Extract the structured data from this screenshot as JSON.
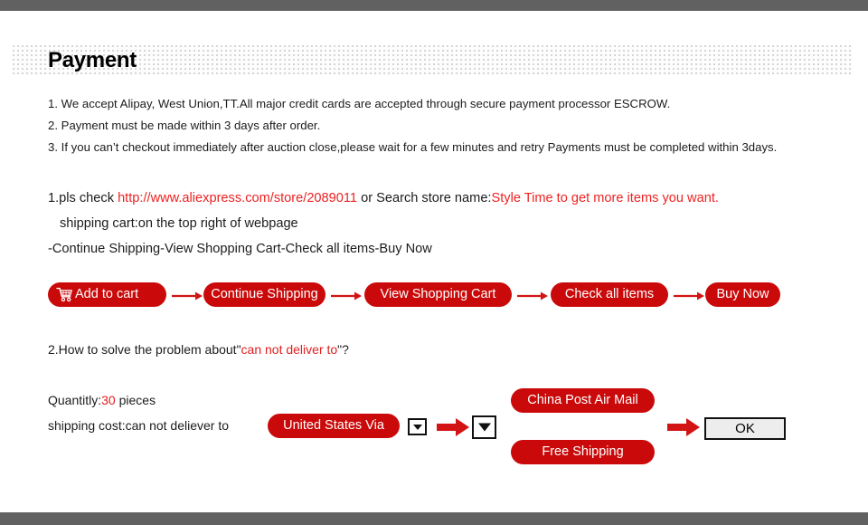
{
  "page": {
    "title": "Payment",
    "accent_red": "#ca0a0a",
    "text_red": "#ee2222",
    "bar_gray": "#616161"
  },
  "terms": {
    "item1": "1. We accept Alipay, West Union,TT.All major credit cards are accepted through secure payment processor ESCROW.",
    "item2": "2. Payment must be made within 3 days after order.",
    "item3": "3. If you can’t checkout immediately after auction close,please wait for a few minutes and retry Payments must be completed within 3days."
  },
  "store": {
    "line1_prefix": "1.pls check ",
    "link": "http://www.aliexpress.com/store/2089011",
    "line1_middle": " or Search store name:",
    "store_name": "Style Time to get more items you want.",
    "line2": "shipping cart:on the top right of webpage",
    "line3": "-Continue Shipping-View Shopping Cart-Check all items-Buy Now"
  },
  "flow": {
    "cart_icon": "shopping-cart-icon",
    "steps": [
      "Add to cart",
      "Continue Shipping",
      "View Shopping Cart",
      "Check all items",
      "Buy Now"
    ]
  },
  "problem": {
    "prefix": "2.How to solve the problem about\"",
    "highlight": "can not deliver to",
    "suffix": "\"?"
  },
  "shipping": {
    "quantity_label": "Quantitly:",
    "quantity_value": "30",
    "quantity_unit": " pieces",
    "cost_label": "shipping cost:can not deliever to",
    "country_pill": "United States Via",
    "dropdown_icon_small": "chevron-down-icon",
    "dropdown_icon_large": "chevron-down-icon",
    "options": [
      "China Post Air Mail",
      "Free Shipping"
    ],
    "confirm_label": "OK"
  }
}
